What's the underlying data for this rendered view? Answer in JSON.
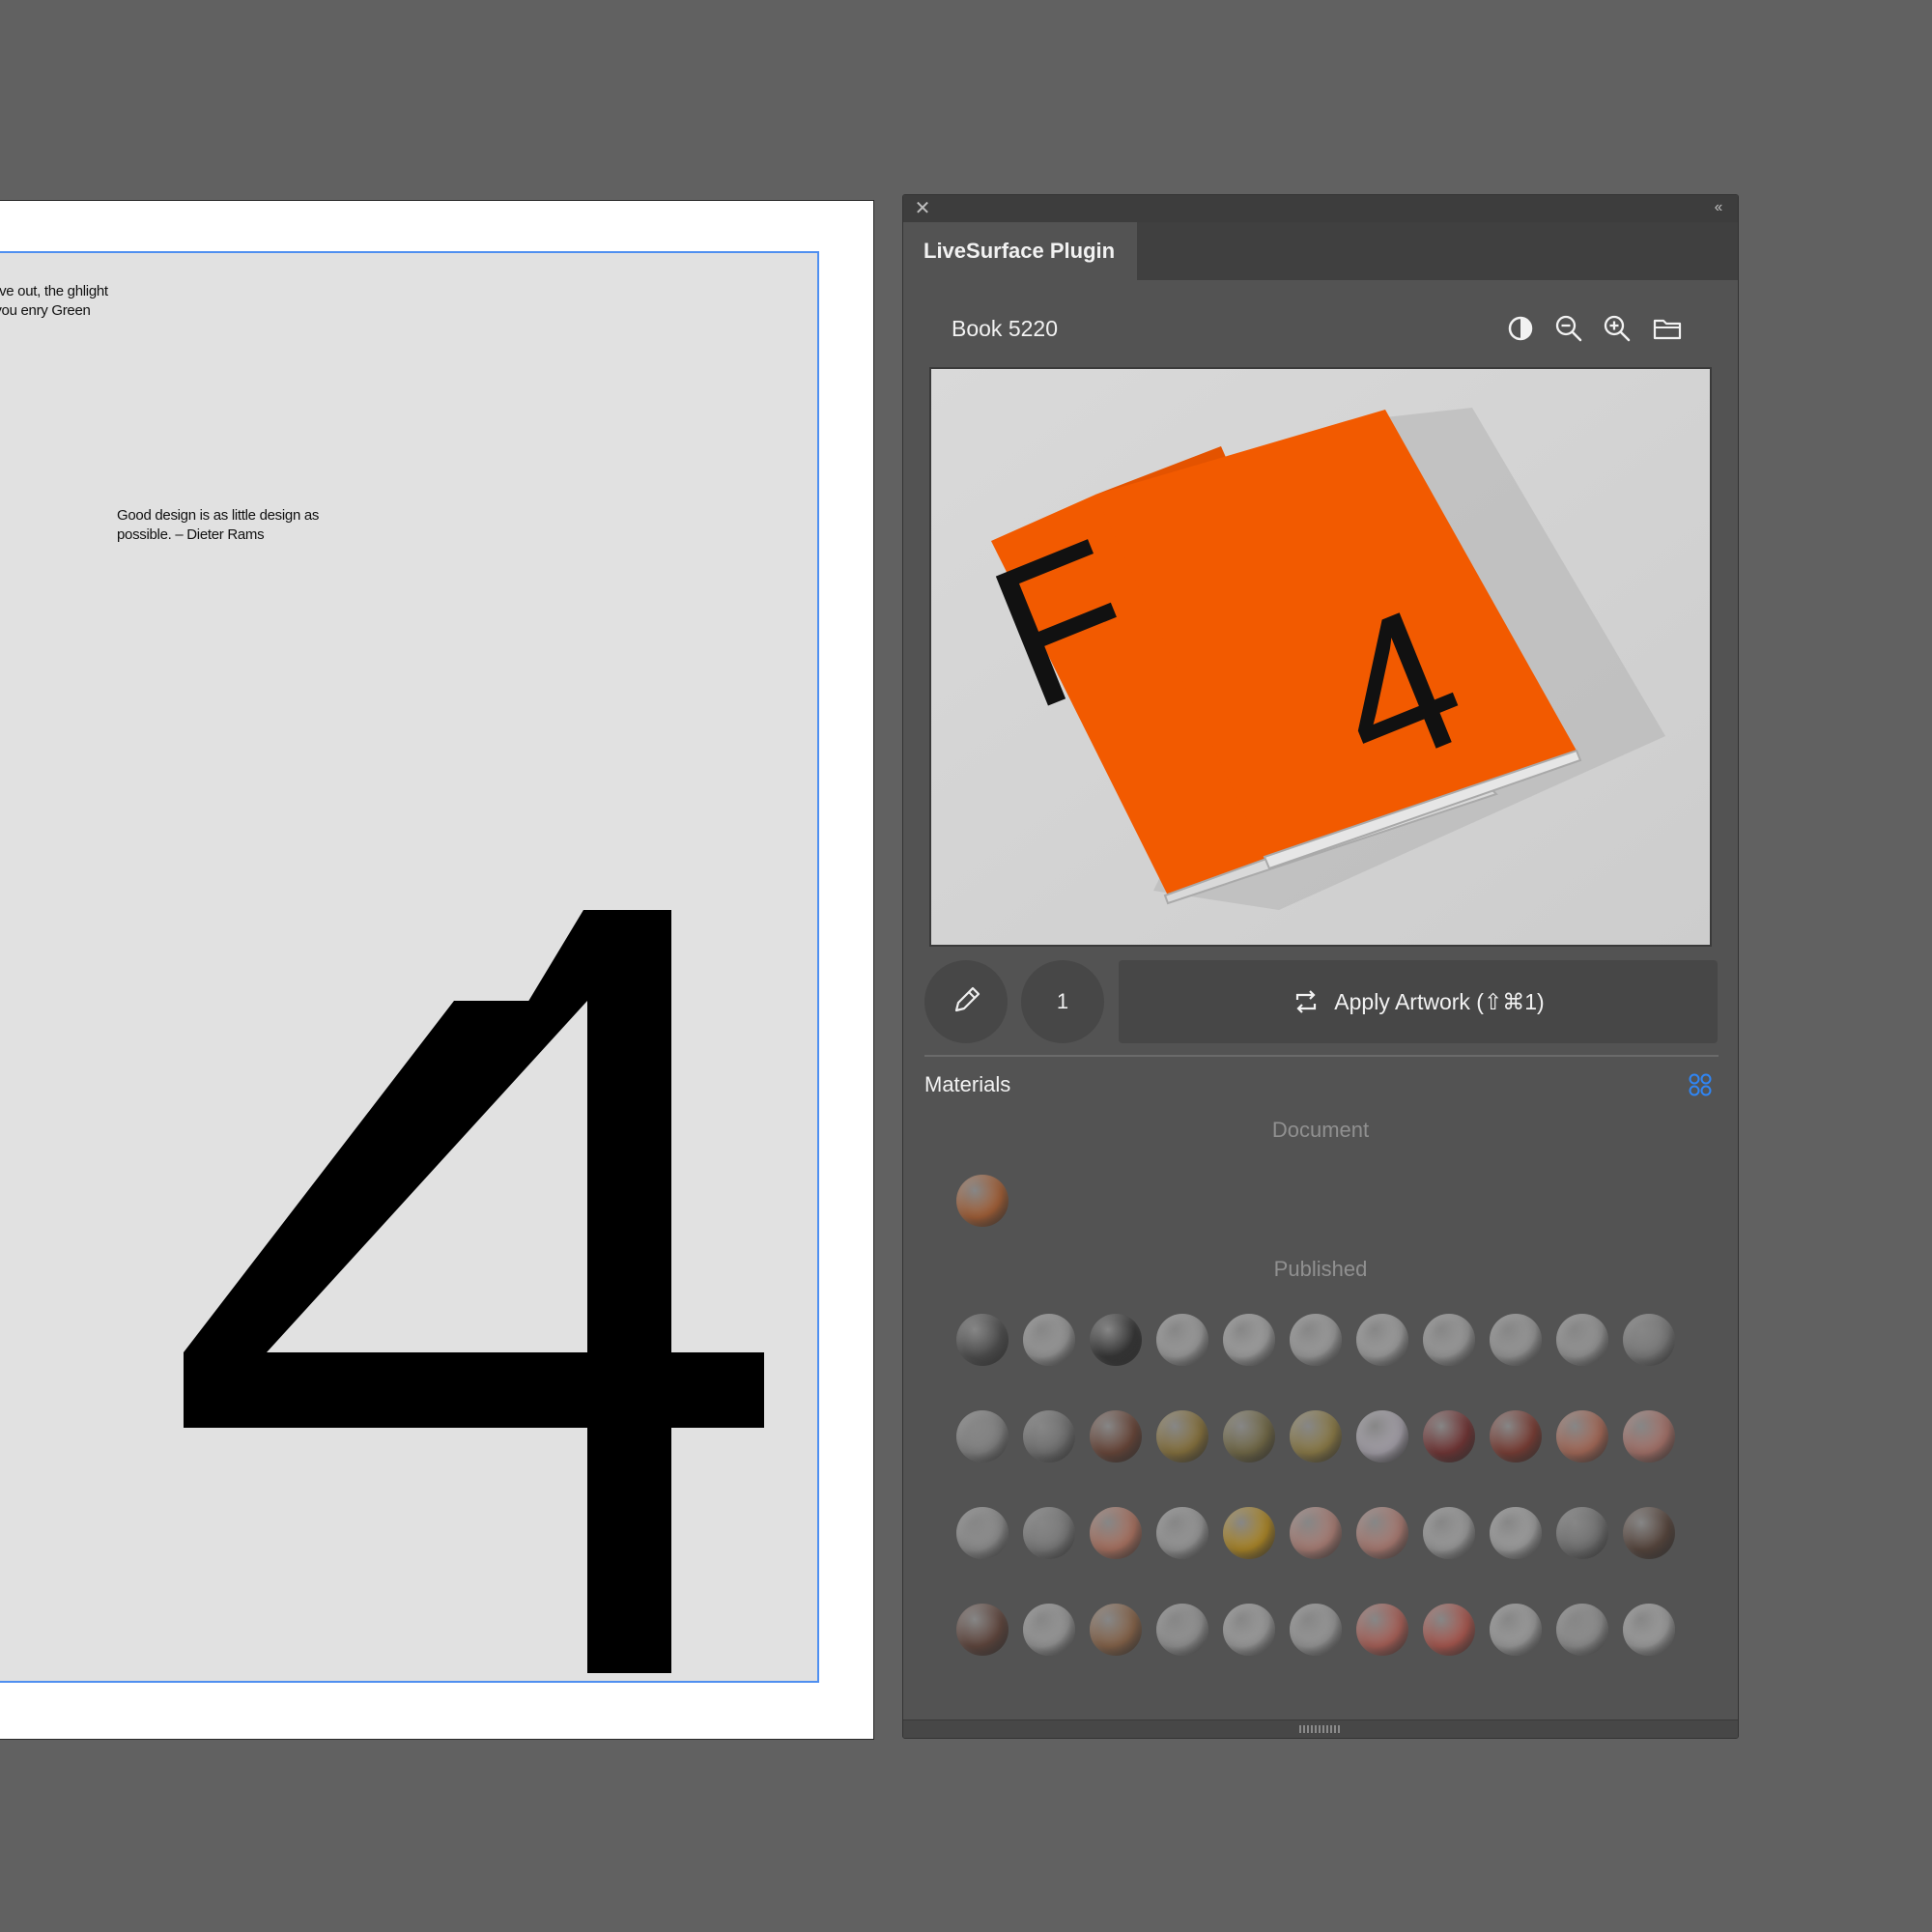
{
  "artboard": {
    "quote_top": "ou leave out, the ghlight what you enry Green",
    "quote_mid": "Good design is as little design as possible. – Dieter Rams",
    "big_numeral": "4",
    "guide_color": "#4f8ff0"
  },
  "panel": {
    "close_icon": "close-icon",
    "collapse_icon": "double-chevron-left-icon",
    "tab_label": "LiveSurface Plugin",
    "mockup_title": "Book 5220",
    "header_icons": [
      "contrast-icon",
      "zoom-out-icon",
      "zoom-in-icon",
      "folder-icon"
    ],
    "preview": {
      "cover_letters": [
        "F",
        "4"
      ],
      "cover_color": "#f25a00"
    },
    "page_count": "1",
    "apply_label": "Apply Artwork (⇧⌘1)",
    "materials_label": "Materials",
    "document_label": "Document",
    "published_label": "Published",
    "accent_color": "#2f86f6",
    "document_swatches": [
      "#e4671c"
    ],
    "published_swatches": [
      [
        "#4a4a4a",
        "#cfcfcf",
        "#1c1c1c",
        "#d6d6d6",
        "#dedede",
        "#d8d8d8",
        "#dadada",
        "#d4d4d4",
        "#cfcfcf",
        "#cacaca",
        "#9a9a9a"
      ],
      [
        "#a8a8a8",
        "#8a8a8a",
        "#7a3a22",
        "#b08a2a",
        "#8a7a3a",
        "#b89a3a",
        "#e8e0f0",
        "#8a1a1a",
        "#9a2a1a",
        "#e87a5a",
        "#e88a7a"
      ],
      [
        "#bdbdbd",
        "#9a9a9a",
        "#f08a6a",
        "#cfcfcf",
        "#f5b000",
        "#f0a090",
        "#f09a8a",
        "#d6d6d6",
        "#dcdcdc",
        "#8a8a8a",
        "#5a3a2a"
      ],
      [
        "#6a3a2a",
        "#cfcfcf",
        "#b07040",
        "#c8c8c8",
        "#d8d8d8",
        "#d0d0d0",
        "#f06a5a",
        "#f05a4a",
        "#d8d8d8",
        "#bfbfbf",
        "#dadada"
      ]
    ]
  }
}
